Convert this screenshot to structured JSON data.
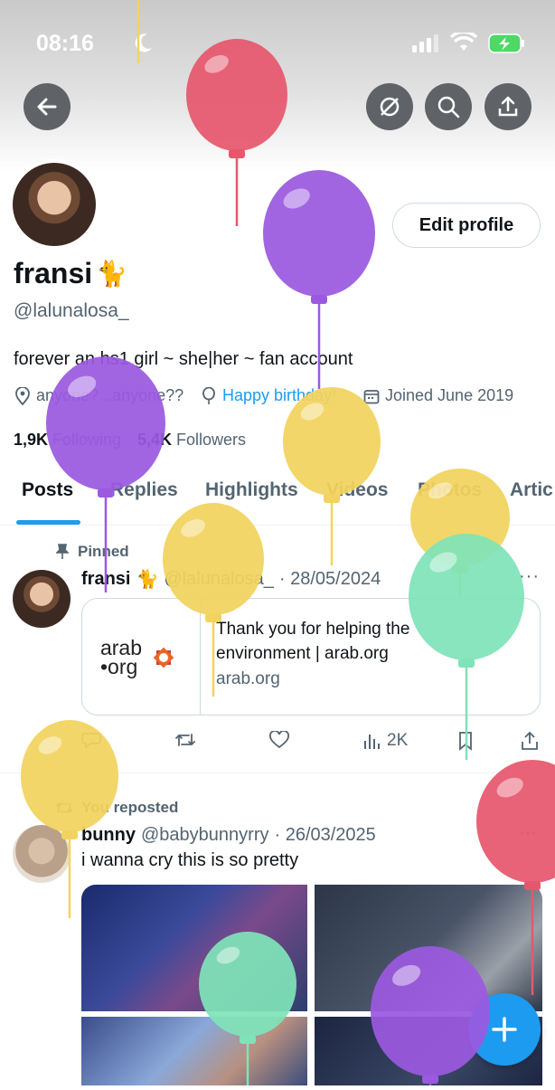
{
  "status_bar": {
    "time": "08:16"
  },
  "profile": {
    "name": "fransi",
    "name_emoji": "🐈",
    "handle": "@lalunalosa_",
    "bio": "forever an hs1 girl ~ she|her ~ fan account",
    "location": "anyone?...anyone??",
    "birthday": "Happy birthday!",
    "joined": "Joined June 2019",
    "following_count": "1,9K",
    "following_label": "Following",
    "followers_count": "5,4K",
    "followers_label": "Followers",
    "edit_label": "Edit profile"
  },
  "tabs": [
    {
      "label": "Posts",
      "active": true
    },
    {
      "label": "Replies"
    },
    {
      "label": "Highlights"
    },
    {
      "label": "Videos"
    },
    {
      "label": "Photos"
    },
    {
      "label": "Artic"
    }
  ],
  "pinned_post": {
    "pinned_label": "Pinned",
    "author": "fransi",
    "author_emoji": "🐈",
    "handle": "@lalunalosa_",
    "date": "· 28/05/2024",
    "card_logo_top": "arab",
    "card_logo_bottom": "•org",
    "card_title": "Thank you for helping the environment | arab.org",
    "card_domain": "arab.org",
    "views": "2K"
  },
  "repost": {
    "repost_label": "You reposted",
    "author": "bunny",
    "handle": "@babybunnyrry",
    "date": "· 26/03/2025",
    "text": "i wanna cry this is so pretty"
  },
  "colors": {
    "accent": "#1d9bf0",
    "text": "#0f1419",
    "muted": "#536471",
    "balloon_red": "#e6576d",
    "balloon_purple": "#9b59e0",
    "balloon_yellow": "#f2d35e",
    "balloon_green": "#7fe3b8"
  },
  "icons": [
    "back-arrow-icon",
    "no-mute-icon",
    "search-icon",
    "share-icon",
    "location-icon",
    "balloon-icon",
    "calendar-icon",
    "pin-icon",
    "reply-icon",
    "retweet-icon",
    "like-icon",
    "views-icon",
    "bookmark-icon",
    "more-icon",
    "compose-plus-icon",
    "wifi-icon",
    "signal-icon",
    "battery-icon",
    "moon-icon"
  ]
}
